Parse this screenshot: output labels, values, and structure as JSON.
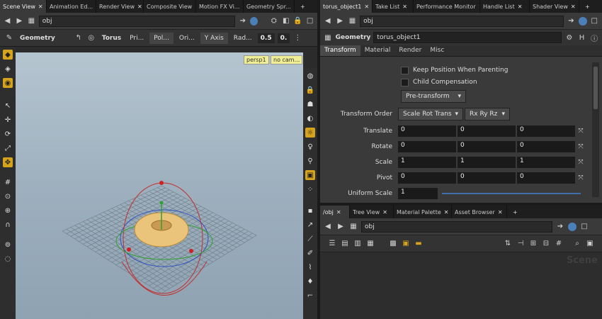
{
  "left_panel": {
    "tabs": [
      {
        "label": "Scene View"
      },
      {
        "label": "Animation Ed..."
      },
      {
        "label": "Render View"
      },
      {
        "label": "Composite View"
      },
      {
        "label": "Motion FX Vi..."
      },
      {
        "label": "Geometry Spr..."
      }
    ],
    "path": "obj",
    "toolbar": {
      "context": "Geometry",
      "object": "Torus",
      "items": [
        "Pri...",
        "Pol...",
        "Ori...",
        "Y Axis",
        "Rad...",
        "0.5",
        "0."
      ]
    },
    "viewport": {
      "camera_label": "persp1",
      "camera_sublabel": "no cam..."
    }
  },
  "right_panel": {
    "tabs": [
      {
        "label": "torus_object1"
      },
      {
        "label": "Take List"
      },
      {
        "label": "Performance Monitor"
      },
      {
        "label": "Handle List"
      },
      {
        "label": "Shader View"
      }
    ],
    "path": "obj",
    "node_type": "Geometry",
    "node_name": "torus_object1",
    "param_tabs": [
      "Transform",
      "Material",
      "Render",
      "Misc"
    ],
    "params": {
      "keep_position_label": "Keep Position When Parenting",
      "child_comp_label": "Child Compensation",
      "pretransform": "Pre-transform",
      "transform_order_label": "Transform Order",
      "transform_order_value": "Scale Rot Trans",
      "rot_order_value": "Rx Ry Rz",
      "translate_label": "Translate",
      "translate": [
        "0",
        "0",
        "0"
      ],
      "rotate_label": "Rotate",
      "rotate": [
        "0",
        "0",
        "0"
      ],
      "scale_label": "Scale",
      "scale": [
        "1",
        "1",
        "1"
      ],
      "pivot_label": "Pivot",
      "pivot": [
        "0",
        "0",
        "0"
      ],
      "uniform_scale_label": "Uniform Scale",
      "uniform_scale": "1"
    }
  },
  "network_panel": {
    "tabs": [
      {
        "label": "/obj"
      },
      {
        "label": "Tree View"
      },
      {
        "label": "Material Palette"
      },
      {
        "label": "Asset Browser"
      }
    ],
    "path": "obj",
    "watermark": "Scene"
  },
  "colors": {
    "accent": "#d6a31d",
    "viewport_top": "#b5c5d0",
    "viewport_bottom": "#8ea2b2",
    "label_bg": "#f0ee94"
  }
}
